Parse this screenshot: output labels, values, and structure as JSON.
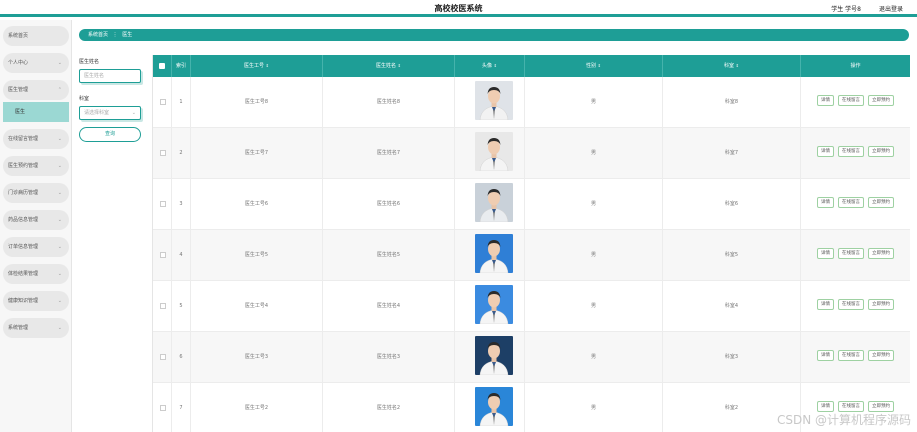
{
  "header": {
    "title": "高校校医系统",
    "user": "学生 学号8",
    "logout": "退出登录"
  },
  "sidebar": {
    "items": [
      {
        "label": "系统首页",
        "chevron": false
      },
      {
        "label": "个人中心",
        "chevron": true
      },
      {
        "label": "医生管理",
        "chevron": true
      },
      {
        "label": "在线留言管理",
        "chevron": true
      },
      {
        "label": "医生预约管理",
        "chevron": true
      },
      {
        "label": "门诊病历管理",
        "chevron": true
      },
      {
        "label": "药品信息管理",
        "chevron": true
      },
      {
        "label": "订单信息管理",
        "chevron": true
      },
      {
        "label": "体检结果管理",
        "chevron": true
      },
      {
        "label": "健康知识管理",
        "chevron": true
      },
      {
        "label": "系统管理",
        "chevron": true
      }
    ],
    "active_sub": "医生"
  },
  "breadcrumb": {
    "home": "系统首页",
    "sep": "⋮",
    "current": "医生"
  },
  "filters": {
    "name_label": "医生姓名",
    "name_placeholder": "医生姓名",
    "dept_label": "科室",
    "dept_placeholder": "请选择科室",
    "query_button": "查询"
  },
  "table": {
    "headers": [
      "索引",
      "医生工号",
      "医生姓名",
      "头像",
      "性别",
      "科室",
      "操作"
    ],
    "sort_icon": "⇕",
    "rows": [
      {
        "index": "1",
        "id": "医生工号8",
        "name": "医生姓名8",
        "gender": "男",
        "dept": "科室8",
        "avatar_bg": "#dfe3e8",
        "coat": "#f2f2f2"
      },
      {
        "index": "2",
        "id": "医生工号7",
        "name": "医生姓名7",
        "gender": "男",
        "dept": "科室7",
        "avatar_bg": "#e8e8e8",
        "coat": "#f4f4f4"
      },
      {
        "index": "3",
        "id": "医生工号6",
        "name": "医生姓名6",
        "gender": "男",
        "dept": "科室6",
        "avatar_bg": "#c9d1d9",
        "coat": "#e9ecef"
      },
      {
        "index": "4",
        "id": "医生工号5",
        "name": "医生姓名5",
        "gender": "男",
        "dept": "科室5",
        "avatar_bg": "#2f7fd6",
        "coat": "#f5f5f5"
      },
      {
        "index": "5",
        "id": "医生工号4",
        "name": "医生姓名4",
        "gender": "男",
        "dept": "科室4",
        "avatar_bg": "#3b8be0",
        "coat": "#f5f5f5"
      },
      {
        "index": "6",
        "id": "医生工号3",
        "name": "医生姓名3",
        "gender": "男",
        "dept": "科室3",
        "avatar_bg": "#1d3f66",
        "coat": "#f5f5f5"
      },
      {
        "index": "7",
        "id": "医生工号2",
        "name": "医生姓名2",
        "gender": "男",
        "dept": "科室2",
        "avatar_bg": "#2a86d8",
        "coat": "#f5f5f5"
      }
    ],
    "actions": [
      "详情",
      "在线留言",
      "立即预约"
    ]
  },
  "watermark": "CSDN @计算机程序源码",
  "colors": {
    "accent": "#1e9e96",
    "active_sub": "#9bd8d3",
    "action_border": "#9ed1a2"
  }
}
